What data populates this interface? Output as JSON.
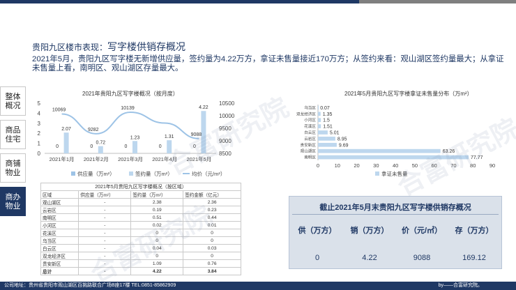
{
  "heading": {
    "prefix": "贵阳九区楼市表现：",
    "title": "写字楼供销存概况"
  },
  "summary": "2021年5月，贵阳九区写字楼无新增供应量，签约量为4.22万方，拿证未售量接近170万方；从签约来看：观山湖区签约量最大；从拿证未售量上看，南明区、观山湖区存量最大。",
  "nav": [
    {
      "label": "整体概况",
      "active": false
    },
    {
      "label": "商品住宅",
      "active": false
    },
    {
      "label": "商铺物业",
      "active": false
    },
    {
      "label": "商办物业",
      "active": true
    }
  ],
  "chart_data": [
    {
      "type": "bar",
      "title": "2021年贵阳九区写字楼概况（按月度）",
      "categories": [
        "2021年1月",
        "2021年2月",
        "2021年3月",
        "2021年4月",
        "2021年5月"
      ],
      "series": [
        {
          "name": "供应量（万m²）",
          "kind": "bar",
          "axis": "left",
          "color": "#9dc3e6",
          "values": [
            0,
            0,
            0,
            0,
            0
          ]
        },
        {
          "name": "签约量（万m²）",
          "kind": "bar",
          "axis": "left",
          "color": "#bdd7ee",
          "values": [
            2.07,
            0.72,
            1.23,
            1.31,
            4.22
          ]
        },
        {
          "name": "均价（元/m²）",
          "kind": "line",
          "axis": "right",
          "color": "#9dc3e6",
          "values": [
            10069,
            9282,
            10139,
            9710,
            9088
          ]
        }
      ],
      "ylim_left": [
        0,
        5
      ],
      "yticks_left": [
        0,
        1,
        2,
        3,
        4,
        5
      ],
      "ylim_right": [
        8500,
        10500
      ],
      "yticks_right": [
        8500,
        9000,
        9500,
        10000,
        10500
      ],
      "point_labels": [
        "10069",
        "9282",
        "10139",
        "",
        "9088"
      ],
      "legend_position": "bottom",
      "grid": false
    },
    {
      "type": "bar",
      "orientation": "horizontal",
      "title": "2021年5月贵阳九区写字楼拿证未售量分布（万m²）",
      "categories": [
        "乌当区",
        "双龙经济区",
        "小河区",
        "花溪区",
        "白云区",
        "云岩区",
        "贵安新区",
        "观山湖区",
        "南明区"
      ],
      "values": [
        0.07,
        1.35,
        1.5,
        1.51,
        5.01,
        8.95,
        9.69,
        63.26,
        77.77
      ],
      "series_name": "拿证未售量",
      "xlim": [
        0,
        90
      ],
      "xticks": [
        0,
        10,
        20,
        30,
        40,
        50,
        60,
        70,
        80,
        90
      ],
      "color": "#bdd7ee",
      "legend_position": "bottom",
      "grid": false
    }
  ],
  "table": {
    "caption": "2021年5月贵阳九区写字楼概况（按区域）",
    "headers": [
      "区域",
      "供应量（万m²）",
      "签约量（万m²）",
      "签约金额（亿元）"
    ],
    "rows": [
      [
        "观山湖区",
        "-",
        "2.38",
        "2.36"
      ],
      [
        "云岩区",
        "-",
        "0.19",
        "0.23"
      ],
      [
        "南明区",
        "-",
        "0.51",
        "0.44"
      ],
      [
        "小河区",
        "-",
        "0.02",
        "0.01"
      ],
      [
        "花溪区",
        "-",
        "0",
        "0"
      ],
      [
        "乌当区",
        "-",
        "0",
        "0"
      ],
      [
        "白云区",
        "-",
        "0.04",
        "0.03"
      ],
      [
        "双龙经济区",
        "-",
        "0",
        "0"
      ],
      [
        "贵安新区",
        "-",
        "1.09",
        "0.76"
      ],
      [
        "总计",
        "-",
        "4.22",
        "3.84"
      ]
    ]
  },
  "stock": {
    "title": "截止2021年5月末贵阳九区写字楼供销存概况",
    "columns": [
      "供（万方）",
      "销（万方）",
      "价（元/㎡）",
      "存（万方）"
    ],
    "values": [
      "0",
      "4.22",
      "9088",
      "169.12"
    ]
  },
  "watermark": "合富研究院",
  "footer": {
    "address": "公司地址：贵州省贵阳市观山湖区百挑路联合广场B座17楼      TEL:0851-85862909",
    "by": "by——合富研究院。"
  },
  "colors": {
    "navy": "#1f3864",
    "bar_light": "#bdd7ee",
    "bar_mid": "#9dc3e6",
    "box_bg": "#dae1ea"
  }
}
